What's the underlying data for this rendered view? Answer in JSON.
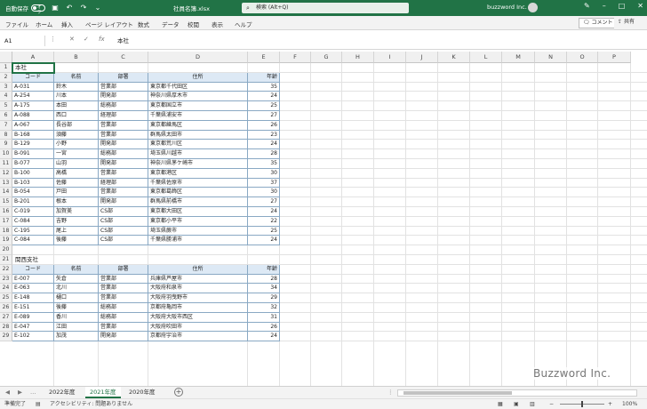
{
  "titlebar": {
    "autosave_label": "自動保存",
    "autosave_state": "オフ",
    "filename": "社員名簿.xlsx",
    "search_placeholder": "検索 (Alt+Q)",
    "user": "buzzword Inc."
  },
  "ribbon": {
    "tabs": [
      "ファイル",
      "ホーム",
      "挿入",
      "ページ レイアウト",
      "数式",
      "データ",
      "校閲",
      "表示",
      "ヘルプ"
    ],
    "comment_button": "コメント",
    "share_button": "共有"
  },
  "formula_bar": {
    "name_box": "A1",
    "value": "本社"
  },
  "columns": [
    "A",
    "B",
    "C",
    "D",
    "E",
    "F",
    "G",
    "H",
    "I",
    "J",
    "K",
    "L",
    "M",
    "N",
    "O",
    "P"
  ],
  "rows": [
    "1",
    "2",
    "3",
    "4",
    "5",
    "6",
    "7",
    "8",
    "9",
    "10",
    "11",
    "12",
    "13",
    "14",
    "15",
    "16",
    "17",
    "18",
    "19",
    "20",
    "21",
    "22",
    "23",
    "24",
    "25",
    "26",
    "27",
    "28",
    "29"
  ],
  "table1": {
    "title": "本社",
    "headers": [
      "コード",
      "名前",
      "部署",
      "住所",
      "年齢"
    ],
    "rows": [
      [
        "A-031",
        "鈴木",
        "営業部",
        "東京都千代田区",
        "35"
      ],
      [
        "A-254",
        "川本",
        "開発部",
        "神奈川県厚木市",
        "24"
      ],
      [
        "A-175",
        "本田",
        "総務部",
        "東京都国立市",
        "25"
      ],
      [
        "A-088",
        "西口",
        "経理部",
        "千葉県浦安市",
        "27"
      ],
      [
        "A-067",
        "長谷部",
        "営業部",
        "東京都練馬区",
        "26"
      ],
      [
        "B-168",
        "須藤",
        "営業部",
        "群馬県太田市",
        "23"
      ],
      [
        "B-129",
        "小野",
        "開発部",
        "東京都荒川区",
        "24"
      ],
      [
        "B-091",
        "一宮",
        "総務部",
        "埼玉県川越市",
        "28"
      ],
      [
        "B-077",
        "山羽",
        "開発部",
        "神奈川県茅ケ崎市",
        "35"
      ],
      [
        "B-100",
        "高橋",
        "営業部",
        "東京都港区",
        "30"
      ],
      [
        "B-103",
        "佐藤",
        "経理部",
        "千葉県佐原市",
        "37"
      ],
      [
        "B-054",
        "戸田",
        "営業部",
        "東京都葛飾区",
        "30"
      ],
      [
        "B-201",
        "根本",
        "開発部",
        "群馬県前橋市",
        "27"
      ],
      [
        "C-019",
        "加賀美",
        "CS部",
        "東京都大田区",
        "24"
      ],
      [
        "C-084",
        "吉野",
        "CS部",
        "東京都小平市",
        "22"
      ],
      [
        "C-195",
        "尾上",
        "CS部",
        "埼玉県蕨市",
        "25"
      ],
      [
        "C-084",
        "後藤",
        "CS部",
        "千葉県勝浦市",
        "24"
      ]
    ]
  },
  "table2": {
    "title": "関西支社",
    "headers": [
      "コード",
      "名前",
      "部署",
      "住所",
      "年齢"
    ],
    "rows": [
      [
        "E-007",
        "矢倉",
        "営業部",
        "兵庫県芦屋市",
        "28"
      ],
      [
        "E-063",
        "北川",
        "営業部",
        "大阪府和泉市",
        "34"
      ],
      [
        "E-148",
        "樋口",
        "営業部",
        "大阪府羽曳野市",
        "29"
      ],
      [
        "E-151",
        "後藤",
        "総務部",
        "京都府亀岡市",
        "32"
      ],
      [
        "E-089",
        "香川",
        "総務部",
        "大阪府大阪市西区",
        "31"
      ],
      [
        "E-047",
        "江田",
        "営業部",
        "大阪府吹田市",
        "26"
      ],
      [
        "E-102",
        "加茂",
        "開発部",
        "京都府宇治市",
        "24"
      ]
    ]
  },
  "sheets": [
    "2022年度",
    "2021年度",
    "2020年度"
  ],
  "active_sheet": "2021年度",
  "status": {
    "ready": "準備完了",
    "accessibility": "アクセシビリティ: 問題ありません",
    "zoom": "100%"
  },
  "watermark": "Buzzword Inc.",
  "colors": {
    "accent": "#217346",
    "table_header": "#dde9f5"
  }
}
